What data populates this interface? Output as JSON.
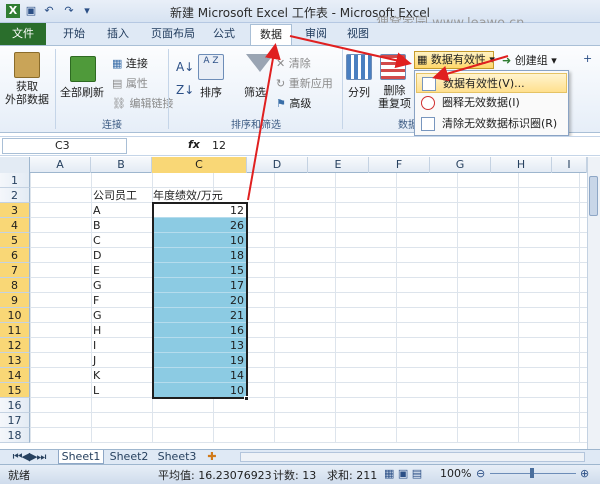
{
  "window": {
    "title": "新建 Microsoft Excel 工作表 - Microsoft Excel",
    "watermark": "狸窝家园 www.leawo.cn"
  },
  "tabs": {
    "file": "文件",
    "home": "开始",
    "insert": "插入",
    "layout": "页面布局",
    "formulas": "公式",
    "data": "数据",
    "review": "审阅",
    "view": "视图"
  },
  "ribbon": {
    "get_external": "获取\n外部数据",
    "refresh_all": "全部刷新",
    "connections": "连接",
    "properties": "属性",
    "edit_links": "编辑链接",
    "group_connections": "连接",
    "sort": "排序",
    "filter": "筛选",
    "clear": "清除",
    "reapply": "重新应用",
    "advanced": "高级",
    "group_sort_filter": "排序和筛选",
    "split": "分列",
    "remove_dup": "删除\n重复项",
    "group_data_tools": "数据",
    "data_validation": "数据有效性",
    "create_group": "创建组"
  },
  "dropdown": {
    "items": [
      "数据有效性(V)...",
      "圈释无效数据(I)",
      "清除无效数据标识圈(R)"
    ]
  },
  "formula_bar": {
    "name_box": "C3",
    "fx": "fx",
    "value": "12"
  },
  "columns": [
    "A",
    "B",
    "C",
    "D",
    "E",
    "F",
    "G",
    "H",
    "I"
  ],
  "rows": [
    "1",
    "2",
    "3",
    "4",
    "5",
    "6",
    "7",
    "8",
    "9",
    "10",
    "11",
    "12",
    "13",
    "14",
    "15",
    "16",
    "17",
    "18"
  ],
  "table": {
    "header_b": "公司员工",
    "header_c": "年度绩效/万元",
    "employees": [
      "A",
      "B",
      "C",
      "D",
      "E",
      "G",
      "F",
      "G",
      "H",
      "I",
      "J",
      "K",
      "L"
    ],
    "values": [
      "12",
      "26",
      "10",
      "18",
      "15",
      "17",
      "20",
      "21",
      "16",
      "13",
      "19",
      "14",
      "10"
    ]
  },
  "sheets": [
    "Sheet1",
    "Sheet2",
    "Sheet3"
  ],
  "status": {
    "ready": "就绪",
    "average": "平均值: 16.23076923",
    "count": "计数: 13",
    "sum": "求和: 211",
    "zoom": "100%"
  },
  "colors": {
    "file_tab": "#2a6e2c",
    "selection": "#8ccbe3",
    "arrow": "#e02020",
    "header_highlight": "#f9d776"
  }
}
